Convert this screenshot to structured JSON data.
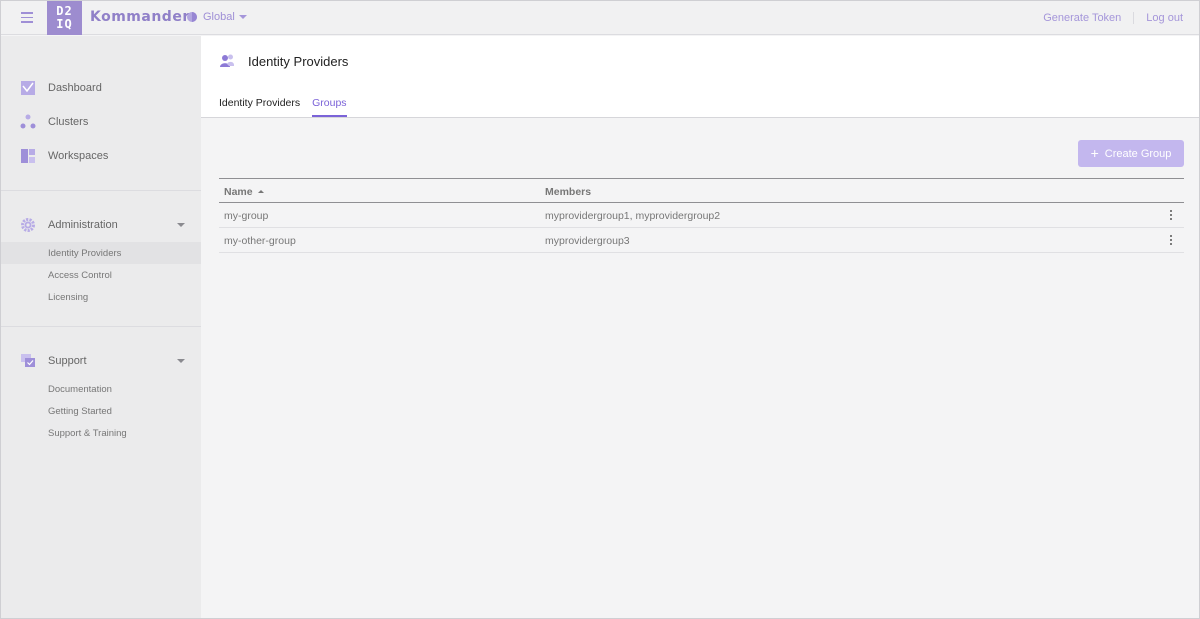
{
  "topbar": {
    "logo_line1": "D2",
    "logo_line2": "IQ",
    "brand": "Kommander",
    "scope": "Global",
    "generate_token": "Generate Token",
    "logout": "Log out"
  },
  "sidebar": {
    "main_items": [
      {
        "label": "Dashboard",
        "icon": "dashboard-icon"
      },
      {
        "label": "Clusters",
        "icon": "clusters-icon"
      },
      {
        "label": "Workspaces",
        "icon": "workspaces-icon"
      }
    ],
    "administration": {
      "label": "Administration",
      "items": [
        "Identity Providers",
        "Access Control",
        "Licensing"
      ]
    },
    "support": {
      "label": "Support",
      "items": [
        "Documentation",
        "Getting Started",
        "Support & Training"
      ]
    }
  },
  "page": {
    "title": "Identity Providers",
    "tabs": [
      "Identity Providers",
      "Groups"
    ],
    "active_tab": "Groups"
  },
  "actions": {
    "create_group": "Create Group"
  },
  "table": {
    "columns": [
      "Name",
      "Members"
    ],
    "rows": [
      {
        "name": "my-group",
        "members": "myprovidergroup1, myprovidergroup2"
      },
      {
        "name": "my-other-group",
        "members": "myprovidergroup3"
      }
    ]
  },
  "colors": {
    "accent": "#7b63d8",
    "accent_light": "#c3b7ee",
    "sidebar_bg": "#ebebec"
  }
}
